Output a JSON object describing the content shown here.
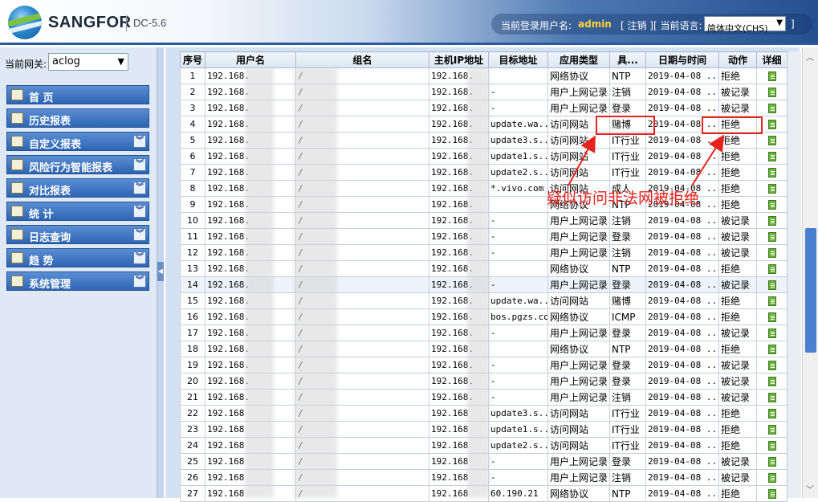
{
  "header": {
    "brand": "SANGFOR",
    "version": "DC-5.6",
    "login_label": "当前登录用户名:",
    "username": "admin",
    "logout": "[ 注销 ]",
    "lang_label": "[ 当前语言:",
    "lang_value": "简体中文(CHS)",
    "lang_close": "]"
  },
  "sidebar": {
    "gateway_label": "当前网关:",
    "gateway_value": "aclog",
    "items": [
      {
        "label": "首  页",
        "expandable": false
      },
      {
        "label": "历史报表",
        "expandable": false
      },
      {
        "label": "自定义报表",
        "expandable": true
      },
      {
        "label": "风险行为智能报表",
        "expandable": true
      },
      {
        "label": "对比报表",
        "expandable": true
      },
      {
        "label": "统  计",
        "expandable": true
      },
      {
        "label": "日志查询",
        "expandable": true
      },
      {
        "label": "趋  势",
        "expandable": true
      },
      {
        "label": "系统管理",
        "expandable": true
      }
    ]
  },
  "table": {
    "columns": [
      "序号",
      "用户名",
      "组名",
      "主机IP地址",
      "目标地址",
      "应用类型",
      "具...",
      "日期与时间",
      "动作",
      "详细"
    ],
    "rows": [
      {
        "no": "1",
        "user": "192.168.",
        "group": "/",
        "ip": "192.168.",
        "target": "",
        "app": "网络协议",
        "detail": "NTP",
        "time": "2019-04-08 ...",
        "action": "拒绝"
      },
      {
        "no": "2",
        "user": "192.168.",
        "group": "/",
        "ip": "192.168.",
        "target": "-",
        "app": "用户上网记录",
        "detail": "注销",
        "time": "2019-04-08 ...",
        "action": "被记录"
      },
      {
        "no": "3",
        "user": "192.168.",
        "group": "/",
        "ip": "192.168.",
        "target": "-",
        "app": "用户上网记录",
        "detail": "登录",
        "time": "2019-04-08 ...",
        "action": "被记录"
      },
      {
        "no": "4",
        "user": "192.168.",
        "group": "/",
        "ip": "192.168.",
        "target": "update.wa...",
        "app": "访问网站",
        "detail": "赌博",
        "time": "2019-04-08 ...",
        "action": "拒绝"
      },
      {
        "no": "5",
        "user": "192.168.",
        "group": "/",
        "ip": "192.168.",
        "target": "update3.s...",
        "app": "访问网站",
        "detail": "IT行业",
        "time": "2019-04-08 ...",
        "action": "拒绝"
      },
      {
        "no": "6",
        "user": "192.168.",
        "group": "/",
        "ip": "192.168.",
        "target": "update1.s...",
        "app": "访问网站",
        "detail": "IT行业",
        "time": "2019-04-08 ...",
        "action": "拒绝"
      },
      {
        "no": "7",
        "user": "192.168.",
        "group": "/",
        "ip": "192.168.",
        "target": "update2.s...",
        "app": "访问网站",
        "detail": "IT行业",
        "time": "2019-04-08 ...",
        "action": "拒绝"
      },
      {
        "no": "8",
        "user": "192.168.",
        "group": "/",
        "ip": "192.168.",
        "target": "*.vivo.com",
        "app": "访问网站",
        "detail": "成人",
        "time": "2019-04-08 ...",
        "action": "拒绝"
      },
      {
        "no": "9",
        "user": "192.168.",
        "group": "/",
        "ip": "192.168.",
        "target": "",
        "app": "网络协议",
        "detail": "NTP",
        "time": "2019-04-08 ...",
        "action": "拒绝"
      },
      {
        "no": "10",
        "user": "192.168.",
        "group": "/",
        "ip": "192.168.",
        "target": "-",
        "app": "用户上网记录",
        "detail": "注销",
        "time": "2019-04-08 ...",
        "action": "被记录"
      },
      {
        "no": "11",
        "user": "192.168.",
        "group": "/",
        "ip": "192.168.",
        "target": "-",
        "app": "用户上网记录",
        "detail": "登录",
        "time": "2019-04-08 ...",
        "action": "被记录"
      },
      {
        "no": "12",
        "user": "192.168.",
        "group": "/",
        "ip": "192.168.",
        "target": "-",
        "app": "用户上网记录",
        "detail": "注销",
        "time": "2019-04-08 ...",
        "action": "被记录"
      },
      {
        "no": "13",
        "user": "192.168.",
        "group": "/",
        "ip": "192.168.",
        "target": "",
        "app": "网络协议",
        "detail": "NTP",
        "time": "2019-04-08 ...",
        "action": "拒绝"
      },
      {
        "no": "14",
        "user": "192.168.",
        "group": "/",
        "ip": "192.168.",
        "target": "-",
        "app": "用户上网记录",
        "detail": "登录",
        "time": "2019-04-08 ...",
        "action": "被记录"
      },
      {
        "no": "15",
        "user": "192.168.",
        "group": "/",
        "ip": "192.168.",
        "target": "update.wa...",
        "app": "访问网站",
        "detail": "赌博",
        "time": "2019-04-08 ...",
        "action": "拒绝"
      },
      {
        "no": "16",
        "user": "192.168.",
        "group": "/",
        "ip": "192.168.",
        "target": "bos.pgzs.com",
        "app": "网络协议",
        "detail": "ICMP",
        "time": "2019-04-08 ...",
        "action": "拒绝"
      },
      {
        "no": "17",
        "user": "192.168.",
        "group": "/",
        "ip": "192.168.",
        "target": "-",
        "app": "用户上网记录",
        "detail": "登录",
        "time": "2019-04-08 ...",
        "action": "被记录"
      },
      {
        "no": "18",
        "user": "192.168.",
        "group": "/",
        "ip": "192.168.",
        "target": "",
        "app": "网络协议",
        "detail": "NTP",
        "time": "2019-04-08 ...",
        "action": "拒绝"
      },
      {
        "no": "19",
        "user": "192.168.",
        "group": "/",
        "ip": "192.168.",
        "target": "-",
        "app": "用户上网记录",
        "detail": "登录",
        "time": "2019-04-08 ...",
        "action": "被记录"
      },
      {
        "no": "20",
        "user": "192.168.",
        "group": "/",
        "ip": "192.168.",
        "target": "-",
        "app": "用户上网记录",
        "detail": "登录",
        "time": "2019-04-08 ...",
        "action": "被记录"
      },
      {
        "no": "21",
        "user": "192.168.",
        "group": "/",
        "ip": "192.168.",
        "target": "-",
        "app": "用户上网记录",
        "detail": "注销",
        "time": "2019-04-08 ...",
        "action": "被记录"
      },
      {
        "no": "22",
        "user": "192.168",
        "group": "/",
        "ip": "192.168",
        "target": "update3.s...",
        "app": "访问网站",
        "detail": "IT行业",
        "time": "2019-04-08 ...",
        "action": "拒绝"
      },
      {
        "no": "23",
        "user": "192.168",
        "group": "/",
        "ip": "192.168",
        "target": "update1.s...",
        "app": "访问网站",
        "detail": "IT行业",
        "time": "2019-04-08 ...",
        "action": "拒绝"
      },
      {
        "no": "24",
        "user": "192.168",
        "group": "/",
        "ip": "192.168",
        "target": "update2.s...",
        "app": "访问网站",
        "detail": "IT行业",
        "time": "2019-04-08 ...",
        "action": "拒绝"
      },
      {
        "no": "25",
        "user": "192.168",
        "group": "/",
        "ip": "192.168",
        "target": "-",
        "app": "用户上网记录",
        "detail": "登录",
        "time": "2019-04-08 ...",
        "action": "被记录"
      },
      {
        "no": "26",
        "user": "192.168",
        "group": "/",
        "ip": "192.168",
        "target": "-",
        "app": "用户上网记录",
        "detail": "注销",
        "time": "2019-04-08 ...",
        "action": "被记录"
      },
      {
        "no": "27",
        "user": "192.168",
        "group": "/",
        "ip": "192.168",
        "target": "60.190.21",
        "app": "网络协议",
        "detail": "NTP",
        "time": "2019-04-08 ...",
        "action": "拒绝"
      }
    ]
  },
  "annotation": {
    "text": "疑似访问非法网被拒绝",
    "color": "#e8221b"
  },
  "colors": {
    "menu_bg": "#2e65b3",
    "header_dark": "#24508f",
    "username": "#ffd23a"
  }
}
